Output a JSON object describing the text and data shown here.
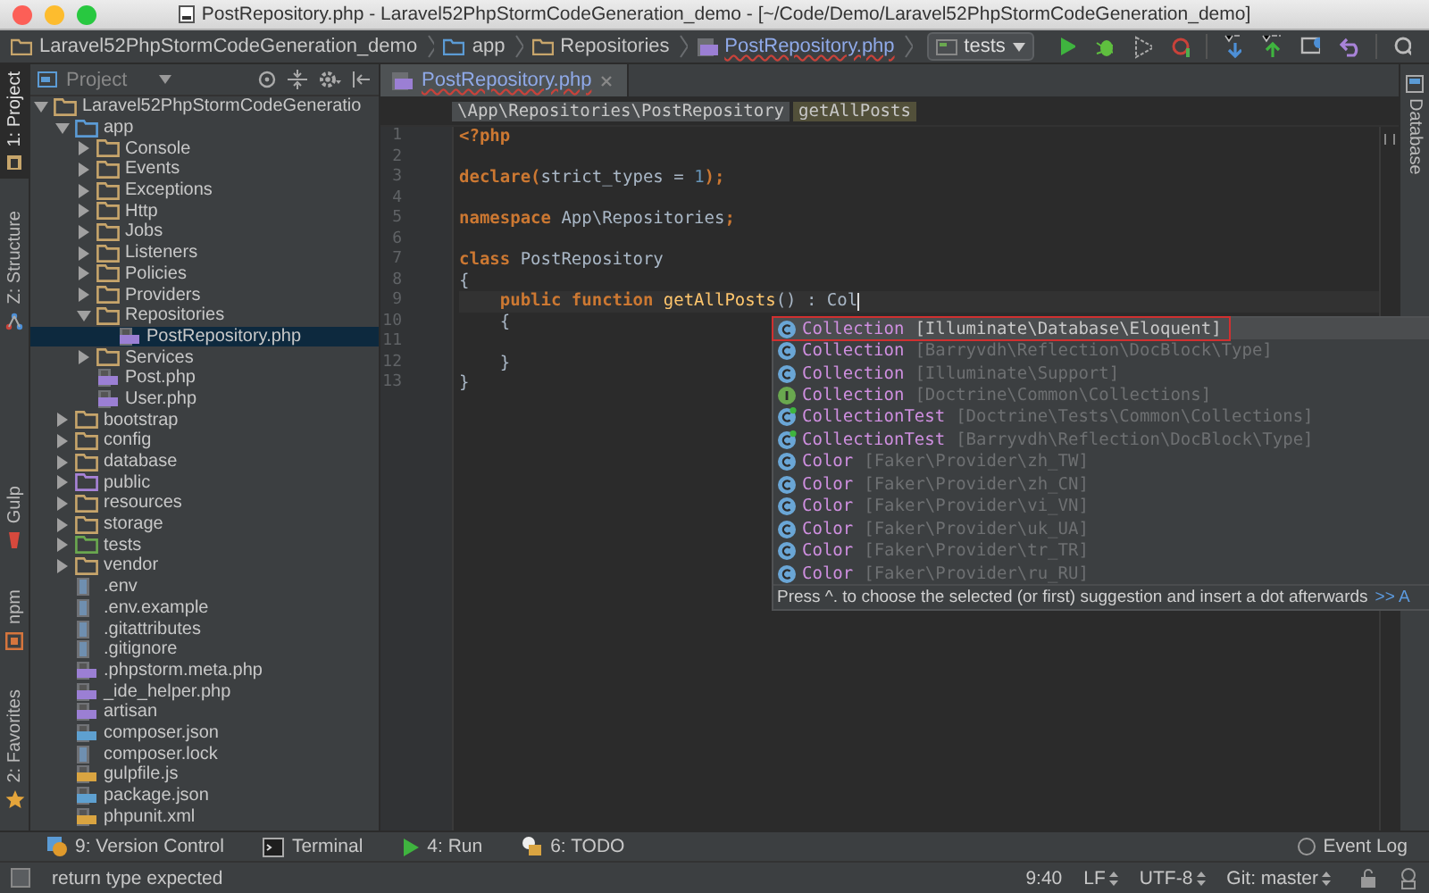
{
  "window": {
    "title": "PostRepository.php - Laravel52PhpStormCodeGeneration_demo - [~/Code/Demo/Laravel52PhpStormCodeGeneration_demo]"
  },
  "navbar": {
    "breadcrumbs": [
      {
        "label": "Laravel52PhpStormCodeGeneration_demo",
        "kind": "folder"
      },
      {
        "label": "app",
        "kind": "source-folder"
      },
      {
        "label": "Repositories",
        "kind": "folder"
      },
      {
        "label": "PostRepository.php",
        "kind": "php-file"
      }
    ],
    "run_config": "tests"
  },
  "left_tool_windows": {
    "top": [
      {
        "label": "1: Project",
        "kind": "project",
        "selected": true
      },
      {
        "label": "Z: Structure",
        "kind": "structure",
        "selected": false
      }
    ],
    "bottom": [
      {
        "label": "Gulp",
        "kind": "gulp",
        "selected": false
      },
      {
        "label": "npm",
        "kind": "npm",
        "selected": false
      },
      {
        "label": "2: Favorites",
        "kind": "favorites",
        "selected": false
      }
    ]
  },
  "project_panel": {
    "title": "Project",
    "tree": [
      {
        "name": "Laravel52PhpStormCodeGeneratio",
        "kind": "folder",
        "expanded": true,
        "selected": false,
        "children": [
          {
            "name": "app",
            "kind": "source-folder",
            "expanded": true,
            "selected": false,
            "children": [
              {
                "name": "Console",
                "kind": "folder",
                "expanded": false,
                "selected": false
              },
              {
                "name": "Events",
                "kind": "folder",
                "expanded": false,
                "selected": false
              },
              {
                "name": "Exceptions",
                "kind": "folder",
                "expanded": false,
                "selected": false
              },
              {
                "name": "Http",
                "kind": "folder",
                "expanded": false,
                "selected": false
              },
              {
                "name": "Jobs",
                "kind": "folder",
                "expanded": false,
                "selected": false
              },
              {
                "name": "Listeners",
                "kind": "folder",
                "expanded": false,
                "selected": false
              },
              {
                "name": "Policies",
                "kind": "folder",
                "expanded": false,
                "selected": false
              },
              {
                "name": "Providers",
                "kind": "folder",
                "expanded": false,
                "selected": false
              },
              {
                "name": "Repositories",
                "kind": "folder",
                "expanded": true,
                "selected": false,
                "children": [
                  {
                    "name": "PostRepository.php",
                    "kind": "php-file",
                    "selected": true
                  }
                ]
              },
              {
                "name": "Services",
                "kind": "folder",
                "expanded": false,
                "selected": false
              },
              {
                "name": "Post.php",
                "kind": "php-file",
                "selected": false
              },
              {
                "name": "User.php",
                "kind": "php-file",
                "selected": false
              }
            ]
          },
          {
            "name": "bootstrap",
            "kind": "folder",
            "expanded": false,
            "selected": false
          },
          {
            "name": "config",
            "kind": "folder",
            "expanded": false,
            "selected": false
          },
          {
            "name": "database",
            "kind": "folder",
            "expanded": false,
            "selected": false
          },
          {
            "name": "public",
            "kind": "resource-folder",
            "expanded": false,
            "selected": false
          },
          {
            "name": "resources",
            "kind": "folder",
            "expanded": false,
            "selected": false
          },
          {
            "name": "storage",
            "kind": "folder",
            "expanded": false,
            "selected": false
          },
          {
            "name": "tests",
            "kind": "test-folder",
            "expanded": false,
            "selected": false
          },
          {
            "name": "vendor",
            "kind": "folder",
            "expanded": false,
            "selected": false
          },
          {
            "name": ".env",
            "kind": "text-file",
            "selected": false
          },
          {
            "name": ".env.example",
            "kind": "text-file",
            "selected": false
          },
          {
            "name": ".gitattributes",
            "kind": "text-file",
            "selected": false
          },
          {
            "name": ".gitignore",
            "kind": "text-file",
            "selected": false
          },
          {
            "name": ".phpstorm.meta.php",
            "kind": "php-file",
            "selected": false
          },
          {
            "name": "_ide_helper.php",
            "kind": "php-file",
            "selected": false
          },
          {
            "name": "artisan",
            "kind": "php-file",
            "selected": false
          },
          {
            "name": "composer.json",
            "kind": "json-file",
            "selected": false
          },
          {
            "name": "composer.lock",
            "kind": "text-file",
            "selected": false
          },
          {
            "name": "gulpfile.js",
            "kind": "js-file",
            "selected": false
          },
          {
            "name": "package.json",
            "kind": "json-file",
            "selected": false
          },
          {
            "name": "phpunit.xml",
            "kind": "xml-file",
            "selected": false
          }
        ]
      }
    ]
  },
  "editor": {
    "tabs": [
      {
        "label": "PostRepository.php",
        "selected": true
      }
    ],
    "breadcrumbs": [
      {
        "label": "\\App\\Repositories\\PostRepository",
        "kind": "class"
      },
      {
        "label": "getAllPosts",
        "kind": "method"
      }
    ],
    "lines": [
      {
        "number": "1",
        "current": false,
        "segments": [
          {
            "kind": "keyword",
            "text": "<?php"
          }
        ]
      },
      {
        "number": "2",
        "current": false
      },
      {
        "number": "3",
        "current": false,
        "segments": [
          {
            "kind": "keyword",
            "text": "declare("
          },
          {
            "kind": "plain",
            "text": "strict_types = "
          },
          {
            "kind": "number",
            "text": "1"
          },
          {
            "kind": "keyword",
            "text": ");"
          }
        ]
      },
      {
        "number": "4",
        "current": false
      },
      {
        "number": "5",
        "current": false,
        "segments": [
          {
            "kind": "keyword",
            "text": "namespace"
          },
          {
            "kind": "plain",
            "text": " App\\Repositories"
          },
          {
            "kind": "keyword",
            "text": ";"
          }
        ]
      },
      {
        "number": "6",
        "current": false
      },
      {
        "number": "7",
        "current": false,
        "segments": [
          {
            "kind": "keyword",
            "text": "class"
          },
          {
            "kind": "plain",
            "text": " PostRepository"
          }
        ]
      },
      {
        "number": "8",
        "current": false,
        "segments": [
          {
            "kind": "plain",
            "text": "{"
          }
        ]
      },
      {
        "number": "9",
        "current": true,
        "segments": [
          {
            "kind": "keyword",
            "text": "    public function "
          },
          {
            "kind": "function",
            "text": "getAllPosts"
          },
          {
            "kind": "plain",
            "text": "() : Col"
          }
        ]
      },
      {
        "number": "10",
        "current": false,
        "segments": [
          {
            "kind": "plain",
            "text": "    {"
          }
        ]
      },
      {
        "number": "11",
        "current": false
      },
      {
        "number": "12",
        "current": false,
        "segments": [
          {
            "kind": "plain",
            "text": "    }"
          }
        ]
      },
      {
        "number": "13",
        "current": false,
        "segments": [
          {
            "kind": "plain",
            "text": "}"
          }
        ]
      }
    ]
  },
  "completion": {
    "items": [
      {
        "name": "Collection",
        "namespace": "[Illuminate\\Database\\Eloquent]",
        "kind": "class",
        "selected": true
      },
      {
        "name": "Collection",
        "namespace": "[Barryvdh\\Reflection\\DocBlock\\Type]",
        "kind": "class",
        "selected": false
      },
      {
        "name": "Collection",
        "namespace": "[Illuminate\\Support]",
        "kind": "class",
        "selected": false
      },
      {
        "name": "Collection",
        "namespace": "[Doctrine\\Common\\Collections]",
        "kind": "interface",
        "selected": false
      },
      {
        "name": "CollectionTest",
        "namespace": "[Doctrine\\Tests\\Common\\Collections]",
        "kind": "test",
        "selected": false
      },
      {
        "name": "CollectionTest",
        "namespace": "[Barryvdh\\Reflection\\DocBlock\\Type]",
        "kind": "test",
        "selected": false
      },
      {
        "name": "Color",
        "namespace": "[Faker\\Provider\\zh_TW]",
        "kind": "class",
        "selected": false
      },
      {
        "name": "Color",
        "namespace": "[Faker\\Provider\\zh_CN]",
        "kind": "class",
        "selected": false
      },
      {
        "name": "Color",
        "namespace": "[Faker\\Provider\\vi_VN]",
        "kind": "class",
        "selected": false
      },
      {
        "name": "Color",
        "namespace": "[Faker\\Provider\\uk_UA]",
        "kind": "class",
        "selected": false
      },
      {
        "name": "Color",
        "namespace": "[Faker\\Provider\\tr_TR]",
        "kind": "class",
        "selected": false
      },
      {
        "name": "Color",
        "namespace": "[Faker\\Provider\\ru_RU]",
        "kind": "class",
        "selected": false
      }
    ],
    "hint": "Press ^. to choose the selected (or first) suggestion and insert a dot afterwards",
    "hint_link": ">> A"
  },
  "right_tool_windows": [
    {
      "label": "Database",
      "selected": false
    }
  ],
  "bottom_tools": [
    {
      "label": "9: Version Control",
      "kind": "vcs"
    },
    {
      "label": "Terminal",
      "kind": "terminal"
    },
    {
      "label": "4: Run",
      "kind": "run"
    },
    {
      "label": "6: TODO",
      "kind": "todo"
    }
  ],
  "event_log": "Event Log",
  "status_bar": {
    "message": "return type expected",
    "items": [
      {
        "label": "9:40",
        "kind": "plain"
      },
      {
        "label": "LF",
        "kind": "select"
      },
      {
        "label": "UTF-8",
        "kind": "select"
      },
      {
        "label": "Git: master",
        "kind": "select"
      }
    ]
  }
}
